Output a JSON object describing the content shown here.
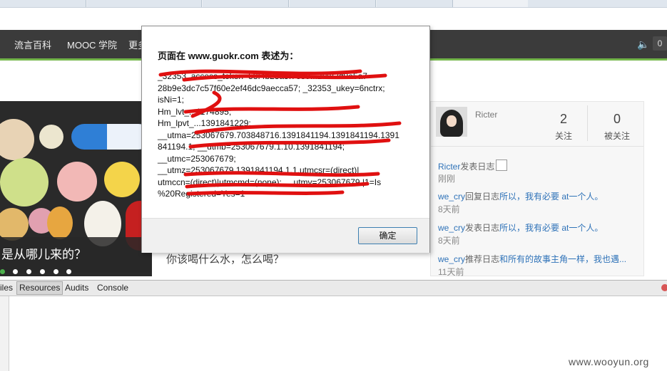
{
  "nav": {
    "items": [
      "流言百科",
      "MOOC 学院",
      "更多"
    ],
    "volume_count": "0"
  },
  "banner": {
    "caption": "是从哪儿来的？"
  },
  "article": {
    "title": "你该喝什么水，怎么喝？"
  },
  "profile": {
    "name": "Ricter",
    "following_count": "2",
    "following_label": "关注",
    "followers_count": "0",
    "followers_label": "被关注"
  },
  "feed": [
    {
      "user": "Ricter",
      "action": "发表日志",
      "link": "",
      "time": "刚刚"
    },
    {
      "user": "we_cry",
      "action": "回复日志",
      "link": "所以，我有必要 at一个人。",
      "time": "8天前"
    },
    {
      "user": "we_cry",
      "action": "发表日志",
      "link": "所以，我有必要 at一个人。",
      "time": "8天前"
    },
    {
      "user": "we_cry",
      "action": "推荐日志",
      "link": "和所有的故事主角一样，我也遇...",
      "time": "11天前"
    }
  ],
  "devtools": {
    "tabs": [
      "iles",
      "Resources",
      "Audits",
      "Console"
    ],
    "active_tab": "Resources"
  },
  "dialog": {
    "title": "页面在 www.guokr.com 表述为：",
    "body": "_32353_access_token=58f4b23a5f7e89...2f482d9e5a7\n28b9e3dc7c57f60e2ef46dc9aecca57; _32353_ukey=6nctrx;\nisNi=1;\nHm_lvt_...1174895;\nHm_lpvt_...1391841229;\n__utma=253067679.703848716.1391841194.1391841194.1391\n841194.1; __utmb=253067679.1.10.1391841194;\n__utmc=253067679;\n__utmz=253067679.1391841194.1.1.utmcsr=(direct)|\nutmccn=(direct)|utmcmd=(none); __utmv=253067679.|1=Is\n%20Registered=Yes=1",
    "ok_label": "确定"
  },
  "watermark": "www.wooyun.org"
}
